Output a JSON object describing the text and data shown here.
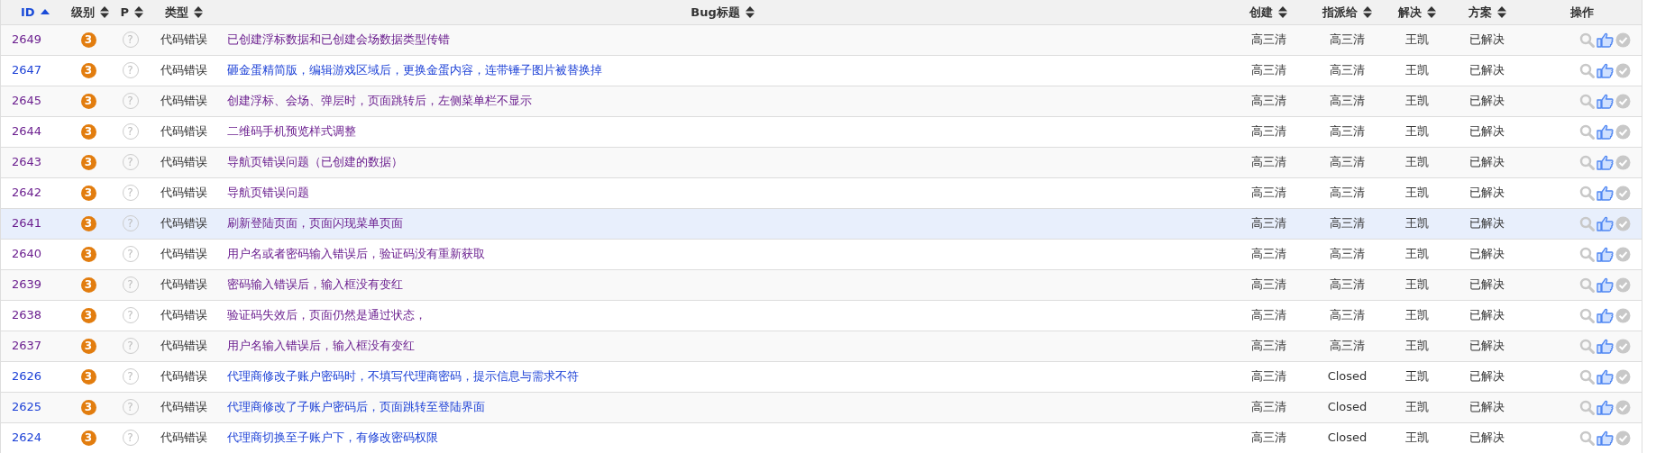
{
  "columns": [
    {
      "label": "ID",
      "sortable": true,
      "sorted_ascending": true
    },
    {
      "label": "级别",
      "sortable": true,
      "sorted_ascending": false
    },
    {
      "label": "P",
      "sortable": true,
      "sorted_ascending": false
    },
    {
      "label": "类型",
      "sortable": true,
      "sorted_ascending": false
    },
    {
      "label": "Bug标题",
      "sortable": true,
      "sorted_ascending": false
    },
    {
      "label": "创建",
      "sortable": true,
      "sorted_ascending": false
    },
    {
      "label": "指派给",
      "sortable": true,
      "sorted_ascending": false
    },
    {
      "label": "解决",
      "sortable": true,
      "sorted_ascending": false
    },
    {
      "label": "方案",
      "sortable": true,
      "sorted_ascending": false
    },
    {
      "label": "操作",
      "sortable": false
    }
  ],
  "rows": [
    {
      "id": "2649",
      "severity": "3",
      "priority": "?",
      "type": "代码错误",
      "title": "已创建浮标数据和已创建会场数据类型传错",
      "visited": true,
      "hovered": false,
      "creator": "高三清",
      "assignee": "高三清",
      "resolver": "王凯",
      "resolution": "已解决"
    },
    {
      "id": "2647",
      "severity": "3",
      "priority": "?",
      "type": "代码错误",
      "title": "砸金蛋精简版，编辑游戏区域后，更换金蛋内容，连带锤子图片被替换掉",
      "visited": false,
      "hovered": false,
      "creator": "高三清",
      "assignee": "高三清",
      "resolver": "王凯",
      "resolution": "已解决"
    },
    {
      "id": "2645",
      "severity": "3",
      "priority": "?",
      "type": "代码错误",
      "title": "创建浮标、会场、弹层时，页面跳转后，左侧菜单栏不显示",
      "visited": true,
      "hovered": false,
      "creator": "高三清",
      "assignee": "高三清",
      "resolver": "王凯",
      "resolution": "已解决"
    },
    {
      "id": "2644",
      "severity": "3",
      "priority": "?",
      "type": "代码错误",
      "title": "二维码手机预览样式调整",
      "visited": true,
      "hovered": false,
      "creator": "高三清",
      "assignee": "高三清",
      "resolver": "王凯",
      "resolution": "已解决"
    },
    {
      "id": "2643",
      "severity": "3",
      "priority": "?",
      "type": "代码错误",
      "title": "导航页错误问题（已创建的数据）",
      "visited": true,
      "hovered": false,
      "creator": "高三清",
      "assignee": "高三清",
      "resolver": "王凯",
      "resolution": "已解决"
    },
    {
      "id": "2642",
      "severity": "3",
      "priority": "?",
      "type": "代码错误",
      "title": "导航页错误问题",
      "visited": true,
      "hovered": false,
      "creator": "高三清",
      "assignee": "高三清",
      "resolver": "王凯",
      "resolution": "已解决"
    },
    {
      "id": "2641",
      "severity": "3",
      "priority": "?",
      "type": "代码错误",
      "title": "刷新登陆页面，页面闪现菜单页面",
      "visited": true,
      "hovered": true,
      "creator": "高三清",
      "assignee": "高三清",
      "resolver": "王凯",
      "resolution": "已解决"
    },
    {
      "id": "2640",
      "severity": "3",
      "priority": "?",
      "type": "代码错误",
      "title": "用户名或者密码输入错误后，验证码没有重新获取",
      "visited": true,
      "hovered": false,
      "creator": "高三清",
      "assignee": "高三清",
      "resolver": "王凯",
      "resolution": "已解决"
    },
    {
      "id": "2639",
      "severity": "3",
      "priority": "?",
      "type": "代码错误",
      "title": "密码输入错误后，输入框没有变红",
      "visited": true,
      "hovered": false,
      "creator": "高三清",
      "assignee": "高三清",
      "resolver": "王凯",
      "resolution": "已解决"
    },
    {
      "id": "2638",
      "severity": "3",
      "priority": "?",
      "type": "代码错误",
      "title": "验证码失效后，页面仍然是通过状态，",
      "visited": true,
      "hovered": false,
      "creator": "高三清",
      "assignee": "高三清",
      "resolver": "王凯",
      "resolution": "已解决"
    },
    {
      "id": "2637",
      "severity": "3",
      "priority": "?",
      "type": "代码错误",
      "title": "用户名输入错误后，输入框没有变红",
      "visited": true,
      "hovered": false,
      "creator": "高三清",
      "assignee": "高三清",
      "resolver": "王凯",
      "resolution": "已解决"
    },
    {
      "id": "2626",
      "severity": "3",
      "priority": "?",
      "type": "代码错误",
      "title": "代理商修改子账户密码时，不填写代理商密码，提示信息与需求不符",
      "visited": false,
      "hovered": false,
      "creator": "高三清",
      "assignee": "Closed",
      "resolver": "王凯",
      "resolution": "已解决"
    },
    {
      "id": "2625",
      "severity": "3",
      "priority": "?",
      "type": "代码错误",
      "title": "代理商修改了子账户密码后，页面跳转至登陆界面",
      "visited": false,
      "hovered": false,
      "creator": "高三清",
      "assignee": "Closed",
      "resolver": "王凯",
      "resolution": "已解决"
    },
    {
      "id": "2624",
      "severity": "3",
      "priority": "?",
      "type": "代码错误",
      "title": "代理商切换至子账户下，有修改密码权限",
      "visited": false,
      "hovered": false,
      "creator": "高三清",
      "assignee": "Closed",
      "resolver": "王凯",
      "resolution": "已解决"
    }
  ]
}
